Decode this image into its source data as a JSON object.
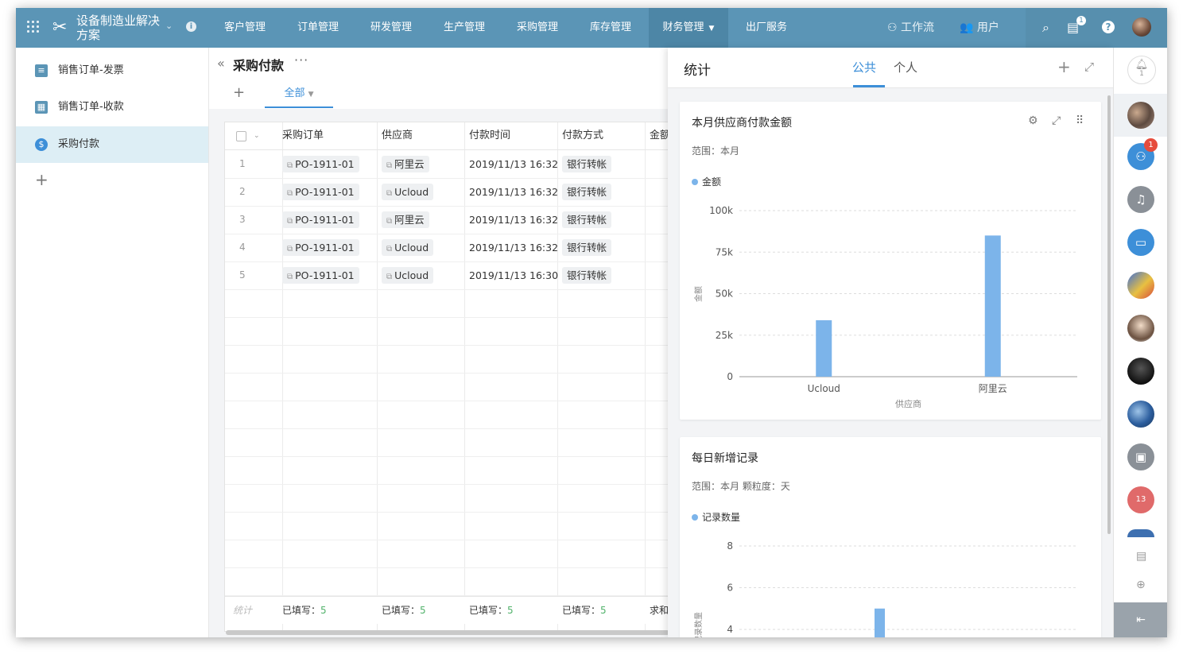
{
  "app": {
    "title": "设备制造业解决方案"
  },
  "nav": {
    "items": [
      "客户管理",
      "订单管理",
      "研发管理",
      "生产管理",
      "采购管理",
      "库存管理",
      "财务管理",
      "出厂服务"
    ],
    "active": "财务管理",
    "workflow": "工作流",
    "users": "用户",
    "notice_badge": "1"
  },
  "sidebar": {
    "items": [
      {
        "label": "销售订单-发票",
        "icon": "invoice-icon",
        "color": "#5b95b6"
      },
      {
        "label": "销售订单-收款",
        "icon": "table-icon",
        "color": "#5b95b6"
      },
      {
        "label": "采购付款",
        "icon": "dollar-icon",
        "color": "#3d8fd8"
      }
    ]
  },
  "main": {
    "title": "采购付款",
    "view_tab": "全部",
    "columns": [
      "采购订单",
      "供应商",
      "付款时间",
      "付款方式",
      "金额"
    ],
    "rows": [
      {
        "num": "1",
        "order": "PO-1911-01",
        "supplier": "阿里云",
        "time": "2019/11/13 16:32",
        "method": "银行转帐"
      },
      {
        "num": "2",
        "order": "PO-1911-01",
        "supplier": "Ucloud",
        "time": "2019/11/13 16:32",
        "method": "银行转帐"
      },
      {
        "num": "3",
        "order": "PO-1911-01",
        "supplier": "阿里云",
        "time": "2019/11/13 16:32",
        "method": "银行转帐"
      },
      {
        "num": "4",
        "order": "PO-1911-01",
        "supplier": "Ucloud",
        "time": "2019/11/13 16:32",
        "method": "银行转帐"
      },
      {
        "num": "5",
        "order": "PO-1911-01",
        "supplier": "Ucloud",
        "time": "2019/11/13 16:30",
        "method": "银行转帐"
      }
    ],
    "footer": {
      "label": "统计",
      "filled_label": "已填写：",
      "filled_value": "5",
      "sum_label": "求和"
    }
  },
  "stats": {
    "title": "统计",
    "tabs": [
      "公共",
      "个人"
    ],
    "active_tab": "公共"
  },
  "chart_data": [
    {
      "type": "bar",
      "title": "本月供应商付款金额",
      "subtitle": "范围：本月",
      "categories": [
        "Ucloud",
        "阿里云"
      ],
      "series": [
        {
          "name": "金额",
          "values": [
            34000,
            85000
          ],
          "color": "#7cb4ea"
        }
      ],
      "xlabel": "供应商",
      "ylabel": "金额",
      "ylim": [
        0,
        100000
      ],
      "yticks": [
        "0",
        "25k",
        "50k",
        "75k",
        "100k"
      ],
      "grid": true,
      "legend": "top-left"
    },
    {
      "type": "bar",
      "title": "每日新增记录",
      "subtitle": "范围：本月   颗粒度：天",
      "series": [
        {
          "name": "记录数量",
          "values": [
            5
          ],
          "color": "#7cb4ea"
        }
      ],
      "ylabel": "记录数量",
      "ylim": [
        0,
        8
      ],
      "yticks": [
        "4",
        "6",
        "8"
      ],
      "grid": true,
      "legend": "top-left"
    }
  ],
  "rail": {
    "bell_count": "1",
    "workflow_badge": "1",
    "calendar_day": "13"
  }
}
